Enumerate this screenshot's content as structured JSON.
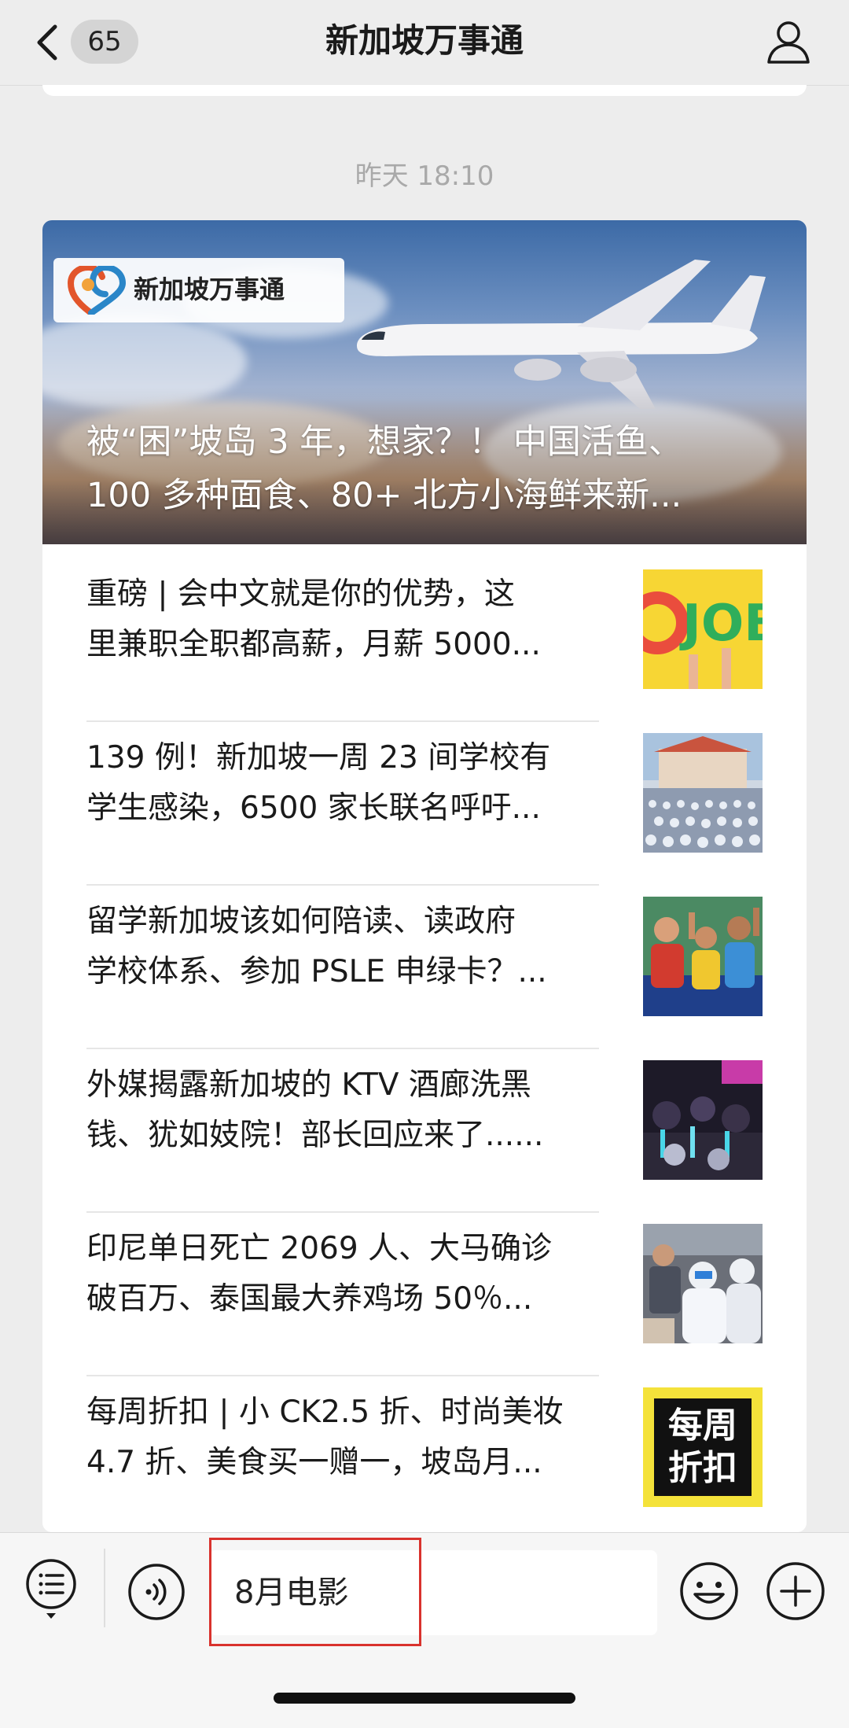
{
  "header": {
    "back_icon": "chevron-left-icon",
    "unread_count": "65",
    "title": "新加坡万事通",
    "profile_icon": "person-icon"
  },
  "timestamp": "昨天 18:10",
  "article_card": {
    "hero": {
      "logo_text": "新加坡万事通",
      "title_lines": [
        "被“困”坡岛 3 年，想家？！ 中国活鱼、",
        "100 多种面食、80+ 北方小海鲜来新..."
      ]
    },
    "items": [
      {
        "lines": [
          "重磅 | 会中文就是你的优势，这",
          "里兼职全职都高薪，月薪 5000..."
        ],
        "thumb_text": "JOBS"
      },
      {
        "lines": [
          "139 例！新加坡一周 23 间学校有",
          "学生感染，6500 家长联名呼吁..."
        ],
        "thumb_text": ""
      },
      {
        "lines": [
          "留学新加坡该如何陪读、读政府",
          "学校体系、参加 PSLE 申绿卡？..."
        ],
        "thumb_text": ""
      },
      {
        "lines": [
          "外媒揭露新加坡的 KTV 酒廊洗黑",
          "钱、犹如妓院！部长回应来了......"
        ],
        "thumb_text": ""
      },
      {
        "lines": [
          "印尼单日死亡 2069 人、大马确诊",
          "破百万、泰国最大养鸡场 50％..."
        ],
        "thumb_text": ""
      },
      {
        "lines": [
          "每周折扣 | 小 CK2.5 折、时尚美妆",
          "4.7 折、美食买一赠一，坡岛月..."
        ],
        "thumb_text": "每周折扣",
        "thumb_lines": [
          "每周",
          "折扣"
        ]
      }
    ]
  },
  "input_bar": {
    "menu_icon": "list-menu-icon",
    "voice_icon": "voice-icon",
    "input_value": "8月电影",
    "emoji_icon": "smile-emoji-icon",
    "plus_icon": "plus-circle-icon"
  },
  "colors": {
    "background": "#ededed",
    "highlight_border": "#d9322d",
    "thumb_yellow": "#f4e23a"
  }
}
